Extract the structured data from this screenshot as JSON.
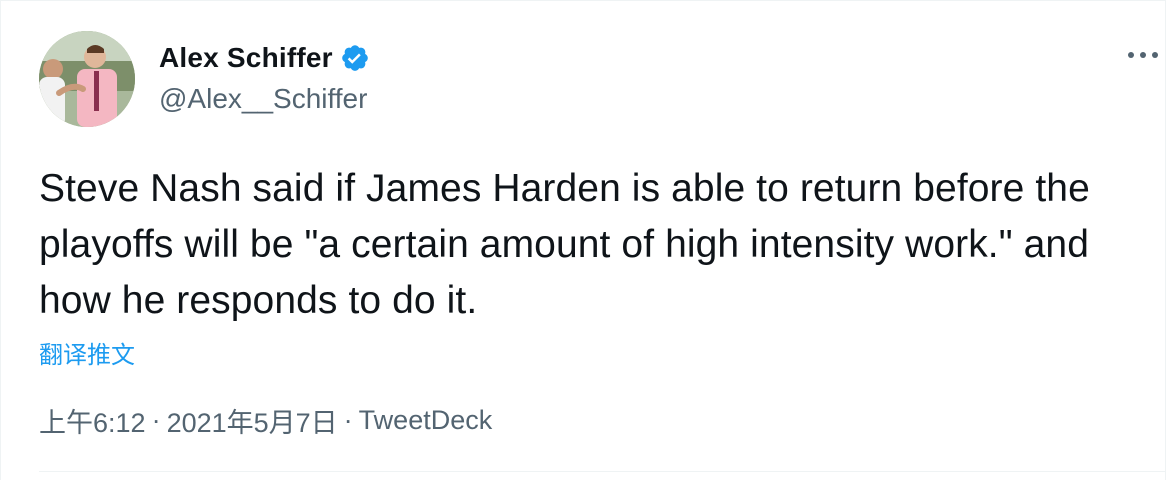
{
  "author": {
    "display_name": "Alex Schiffer",
    "handle": "@Alex__Schiffer",
    "verified": true
  },
  "tweet": {
    "text": "Steve Nash said if James Harden is able to return before the playoffs will be \"a certain amount of high intensity work.\" and how he responds to do it.",
    "translate_label": "翻译推文"
  },
  "meta": {
    "time": "上午6:12",
    "separator": "·",
    "date": "2021年5月7日",
    "source": "TweetDeck"
  },
  "colors": {
    "link": "#1d9bf0",
    "secondary_text": "#536471",
    "verified_badge": "#1d9bf0"
  }
}
